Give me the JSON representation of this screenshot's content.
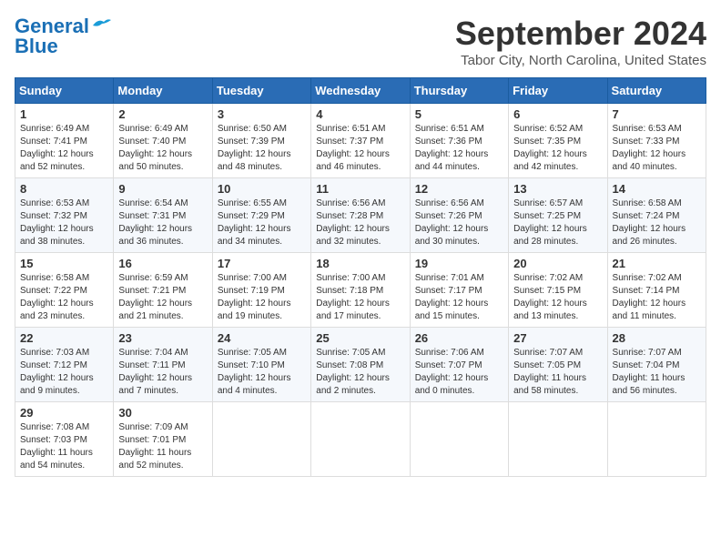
{
  "logo": {
    "line1": "General",
    "line2": "Blue"
  },
  "title": "September 2024",
  "location": "Tabor City, North Carolina, United States",
  "weekdays": [
    "Sunday",
    "Monday",
    "Tuesday",
    "Wednesday",
    "Thursday",
    "Friday",
    "Saturday"
  ],
  "weeks": [
    [
      {
        "day": "1",
        "sunrise": "6:49 AM",
        "sunset": "7:41 PM",
        "daylight": "12 hours and 52 minutes."
      },
      {
        "day": "2",
        "sunrise": "6:49 AM",
        "sunset": "7:40 PM",
        "daylight": "12 hours and 50 minutes."
      },
      {
        "day": "3",
        "sunrise": "6:50 AM",
        "sunset": "7:39 PM",
        "daylight": "12 hours and 48 minutes."
      },
      {
        "day": "4",
        "sunrise": "6:51 AM",
        "sunset": "7:37 PM",
        "daylight": "12 hours and 46 minutes."
      },
      {
        "day": "5",
        "sunrise": "6:51 AM",
        "sunset": "7:36 PM",
        "daylight": "12 hours and 44 minutes."
      },
      {
        "day": "6",
        "sunrise": "6:52 AM",
        "sunset": "7:35 PM",
        "daylight": "12 hours and 42 minutes."
      },
      {
        "day": "7",
        "sunrise": "6:53 AM",
        "sunset": "7:33 PM",
        "daylight": "12 hours and 40 minutes."
      }
    ],
    [
      {
        "day": "8",
        "sunrise": "6:53 AM",
        "sunset": "7:32 PM",
        "daylight": "12 hours and 38 minutes."
      },
      {
        "day": "9",
        "sunrise": "6:54 AM",
        "sunset": "7:31 PM",
        "daylight": "12 hours and 36 minutes."
      },
      {
        "day": "10",
        "sunrise": "6:55 AM",
        "sunset": "7:29 PM",
        "daylight": "12 hours and 34 minutes."
      },
      {
        "day": "11",
        "sunrise": "6:56 AM",
        "sunset": "7:28 PM",
        "daylight": "12 hours and 32 minutes."
      },
      {
        "day": "12",
        "sunrise": "6:56 AM",
        "sunset": "7:26 PM",
        "daylight": "12 hours and 30 minutes."
      },
      {
        "day": "13",
        "sunrise": "6:57 AM",
        "sunset": "7:25 PM",
        "daylight": "12 hours and 28 minutes."
      },
      {
        "day": "14",
        "sunrise": "6:58 AM",
        "sunset": "7:24 PM",
        "daylight": "12 hours and 26 minutes."
      }
    ],
    [
      {
        "day": "15",
        "sunrise": "6:58 AM",
        "sunset": "7:22 PM",
        "daylight": "12 hours and 23 minutes."
      },
      {
        "day": "16",
        "sunrise": "6:59 AM",
        "sunset": "7:21 PM",
        "daylight": "12 hours and 21 minutes."
      },
      {
        "day": "17",
        "sunrise": "7:00 AM",
        "sunset": "7:19 PM",
        "daylight": "12 hours and 19 minutes."
      },
      {
        "day": "18",
        "sunrise": "7:00 AM",
        "sunset": "7:18 PM",
        "daylight": "12 hours and 17 minutes."
      },
      {
        "day": "19",
        "sunrise": "7:01 AM",
        "sunset": "7:17 PM",
        "daylight": "12 hours and 15 minutes."
      },
      {
        "day": "20",
        "sunrise": "7:02 AM",
        "sunset": "7:15 PM",
        "daylight": "12 hours and 13 minutes."
      },
      {
        "day": "21",
        "sunrise": "7:02 AM",
        "sunset": "7:14 PM",
        "daylight": "12 hours and 11 minutes."
      }
    ],
    [
      {
        "day": "22",
        "sunrise": "7:03 AM",
        "sunset": "7:12 PM",
        "daylight": "12 hours and 9 minutes."
      },
      {
        "day": "23",
        "sunrise": "7:04 AM",
        "sunset": "7:11 PM",
        "daylight": "12 hours and 7 minutes."
      },
      {
        "day": "24",
        "sunrise": "7:05 AM",
        "sunset": "7:10 PM",
        "daylight": "12 hours and 4 minutes."
      },
      {
        "day": "25",
        "sunrise": "7:05 AM",
        "sunset": "7:08 PM",
        "daylight": "12 hours and 2 minutes."
      },
      {
        "day": "26",
        "sunrise": "7:06 AM",
        "sunset": "7:07 PM",
        "daylight": "12 hours and 0 minutes."
      },
      {
        "day": "27",
        "sunrise": "7:07 AM",
        "sunset": "7:05 PM",
        "daylight": "11 hours and 58 minutes."
      },
      {
        "day": "28",
        "sunrise": "7:07 AM",
        "sunset": "7:04 PM",
        "daylight": "11 hours and 56 minutes."
      }
    ],
    [
      {
        "day": "29",
        "sunrise": "7:08 AM",
        "sunset": "7:03 PM",
        "daylight": "11 hours and 54 minutes."
      },
      {
        "day": "30",
        "sunrise": "7:09 AM",
        "sunset": "7:01 PM",
        "daylight": "11 hours and 52 minutes."
      },
      null,
      null,
      null,
      null,
      null
    ]
  ]
}
